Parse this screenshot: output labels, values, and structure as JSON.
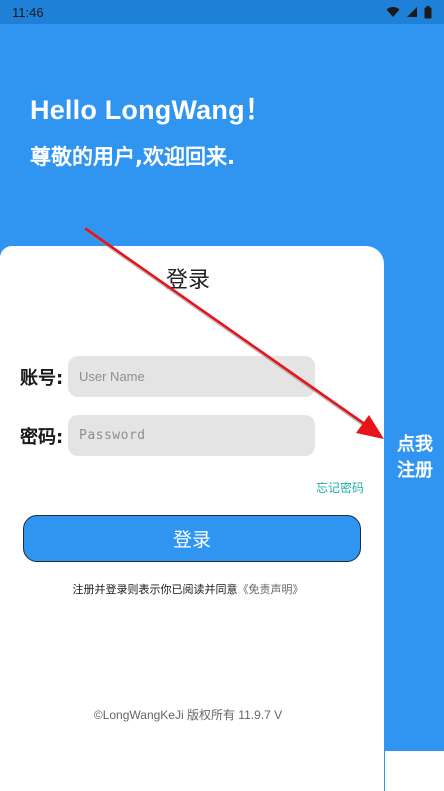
{
  "status_bar": {
    "time": "11:46"
  },
  "header": {
    "greeting": "Hello LongWang！",
    "welcome": "尊敬的用户,欢迎回来."
  },
  "login_card": {
    "title": "登录",
    "account_label": "账号:",
    "account_placeholder": "User Name",
    "password_label": "密码:",
    "password_placeholder": "Password",
    "forgot_password": "忘记密码",
    "login_button": "登录",
    "agreement_prefix": "注册并登录则表示你已阅读并同意",
    "agreement_link": "《免责声明》",
    "copyright": "©LongWangKeJi 版权所有 11.9.7 V"
  },
  "register_tab": {
    "label": "点我注册"
  },
  "colors": {
    "primary": "#2F95F0",
    "status_bar": "#1E80D6",
    "annotation_arrow": "#E8141C",
    "forgot_link": "#1BB0A8"
  }
}
